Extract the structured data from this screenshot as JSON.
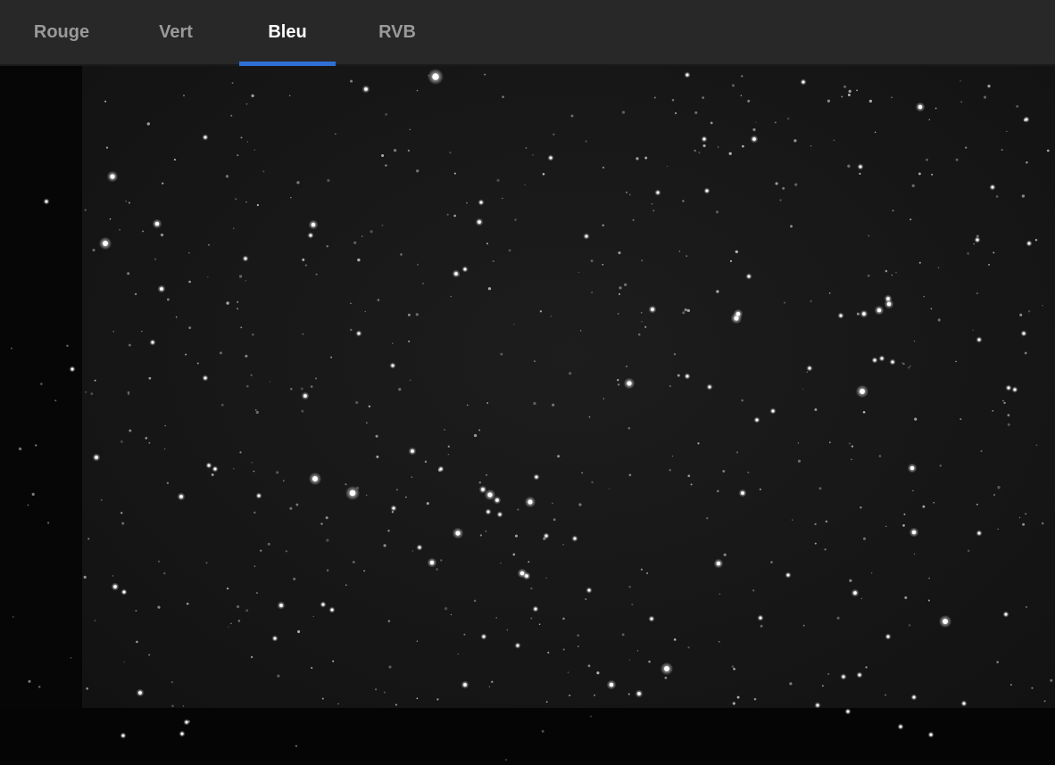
{
  "tabs": [
    {
      "label": "Rouge",
      "active": false
    },
    {
      "label": "Vert",
      "active": false
    },
    {
      "label": "Bleu",
      "active": true
    },
    {
      "label": "RVB",
      "active": false
    }
  ],
  "colors": {
    "active_tab_indicator": "#2f6fd6",
    "tabbar_background": "#282828",
    "active_tab_text": "#ffffff",
    "inactive_tab_text": "#9a9a9a"
  },
  "image": {
    "channel": "Bleu",
    "content": "starfield-grayscale"
  }
}
